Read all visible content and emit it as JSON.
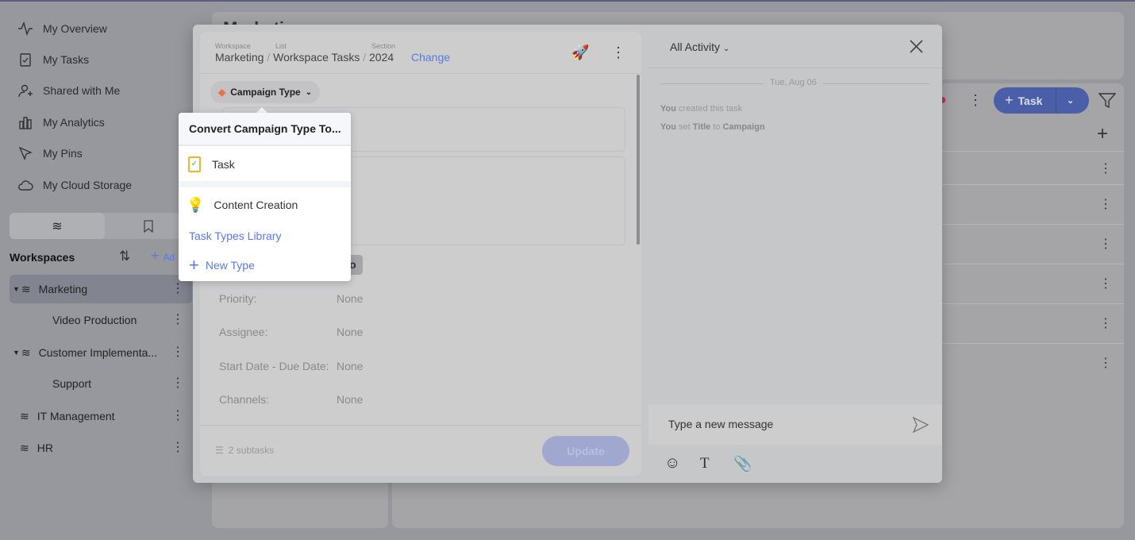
{
  "sidebar": {
    "items": [
      {
        "label": "My Overview",
        "icon": "activity-icon"
      },
      {
        "label": "My Tasks",
        "icon": "task-icon"
      },
      {
        "label": "Shared with Me",
        "icon": "user-share-icon"
      },
      {
        "label": "My Analytics",
        "icon": "bar-chart-icon"
      },
      {
        "label": "My Pins",
        "icon": "pin-icon"
      },
      {
        "label": "My Cloud Storage",
        "icon": "cloud-icon"
      }
    ],
    "workspaces_title": "Workspaces",
    "add_label": "Ad",
    "workspaces": [
      {
        "label": "Marketing",
        "selected": true,
        "expanded": true
      },
      {
        "label": "Video Production",
        "child": true
      },
      {
        "label": "Customer Implementa...",
        "expanded": true
      },
      {
        "label": "Support",
        "child": true
      },
      {
        "label": "IT Management"
      },
      {
        "label": "HR"
      }
    ]
  },
  "background": {
    "title": "Marketing",
    "task_button": "Task"
  },
  "modal": {
    "breadcrumb": {
      "workspace_label": "Workspace",
      "workspace": "Marketing",
      "list_label": "List",
      "list": "Workspace Tasks",
      "section_label": "Section",
      "section": "2024",
      "change": "Change"
    },
    "type_chip": "Campaign Type",
    "status": "To Do",
    "fields": [
      {
        "label": "Priority:",
        "value": "None"
      },
      {
        "label": "Assignee:",
        "value": "None"
      },
      {
        "label": "Start Date - Due Date:",
        "value": "None"
      },
      {
        "label": "Channels:",
        "value": "None"
      }
    ],
    "subtasks": "2 subtasks",
    "update": "Update",
    "activity": {
      "filter": "All Activity",
      "date": "Tue, Aug 06",
      "entries": [
        {
          "actor": "You",
          "text": " created this task"
        },
        {
          "actor": "You",
          "text": " set ",
          "field": "Title",
          "to": " to ",
          "value": "Campaign"
        }
      ],
      "message_placeholder": "Type a new message"
    }
  },
  "menu": {
    "title": "Convert Campaign Type To...",
    "items": [
      "Task",
      "Content Creation"
    ],
    "library": "Task Types Library",
    "new_type": "New Type"
  },
  "colors": {
    "accent": "#5a78e8",
    "overlay_bg": "#97989e",
    "rocket": "#d63a6a"
  }
}
